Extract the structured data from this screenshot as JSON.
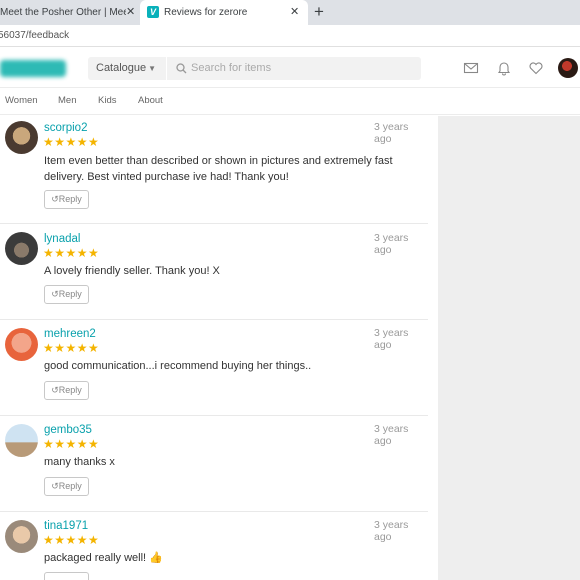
{
  "browser": {
    "tabs": [
      {
        "title": "Meet the Posher Other | Meet Yo",
        "active": false
      },
      {
        "title": "Reviews for zerore",
        "active": true
      }
    ],
    "new_tab": "+",
    "close": "✕",
    "url": "56037/feedback"
  },
  "header": {
    "catalog_label": "Catalogue",
    "search_placeholder": "Search for items",
    "icons": [
      "mail-icon",
      "bell-icon",
      "heart-icon",
      "avatar"
    ],
    "brand_color": "#09b1ba"
  },
  "nav": {
    "items": [
      "Women",
      "Men",
      "Kids",
      "About"
    ]
  },
  "reviews": [
    {
      "user": "scorpio2",
      "stars": "★★★★★",
      "date": "3 years ago",
      "text": "Item even better than described or shown in pictures and extremely fast delivery. Best vinted purchase ive had! Thank you!",
      "reply": "Reply"
    },
    {
      "user": "lynadal",
      "stars": "★★★★★",
      "date": "3 years ago",
      "text": "A lovely friendly seller. Thank you! X",
      "reply": "Reply"
    },
    {
      "user": "mehreen2",
      "stars": "★★★★★",
      "date": "3 years ago",
      "text": "good communication...i recommend buying her things..",
      "reply": "Reply"
    },
    {
      "user": "gembo35",
      "stars": "★★★★★",
      "date": "3 years ago",
      "text": "many thanks x",
      "reply": "Reply"
    },
    {
      "user": "tina1971",
      "stars": "★★★★★",
      "date": "3 years ago",
      "text": "packaged really well! 👍",
      "reply": "Reply"
    }
  ],
  "reply_icon": "↺"
}
